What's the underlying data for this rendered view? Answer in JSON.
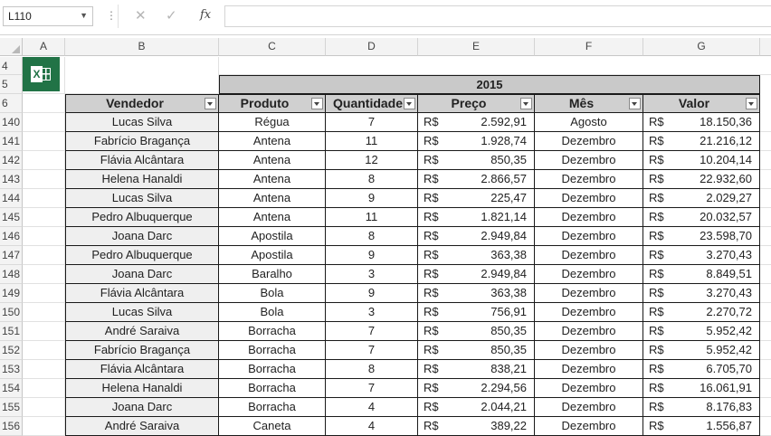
{
  "formula_bar": {
    "name_box": "L110",
    "fx": "fx",
    "cancel": "✕",
    "enter": "✓",
    "formula": ""
  },
  "columns": [
    "A",
    "B",
    "C",
    "D",
    "E",
    "F",
    "G"
  ],
  "top_rows": [
    "4",
    "5",
    "6"
  ],
  "table": {
    "year": "2015",
    "headers": [
      "Vendedor",
      "Produto",
      "Quantidade",
      "Preço",
      "Mês",
      "Valor"
    ],
    "currency": "R$",
    "rows": [
      {
        "row": "140",
        "vendedor": "Lucas Silva",
        "produto": "Régua",
        "qtd": "7",
        "preco": "2.592,91",
        "mes": "Agosto",
        "valor": "18.150,36"
      },
      {
        "row": "141",
        "vendedor": "Fabrício Bragança",
        "produto": "Antena",
        "qtd": "11",
        "preco": "1.928,74",
        "mes": "Dezembro",
        "valor": "21.216,12"
      },
      {
        "row": "142",
        "vendedor": "Flávia Alcântara",
        "produto": "Antena",
        "qtd": "12",
        "preco": "850,35",
        "mes": "Dezembro",
        "valor": "10.204,14"
      },
      {
        "row": "143",
        "vendedor": "Helena Hanaldi",
        "produto": "Antena",
        "qtd": "8",
        "preco": "2.866,57",
        "mes": "Dezembro",
        "valor": "22.932,60"
      },
      {
        "row": "144",
        "vendedor": "Lucas Silva",
        "produto": "Antena",
        "qtd": "9",
        "preco": "225,47",
        "mes": "Dezembro",
        "valor": "2.029,27"
      },
      {
        "row": "145",
        "vendedor": "Pedro Albuquerque",
        "produto": "Antena",
        "qtd": "11",
        "preco": "1.821,14",
        "mes": "Dezembro",
        "valor": "20.032,57"
      },
      {
        "row": "146",
        "vendedor": "Joana Darc",
        "produto": "Apostila",
        "qtd": "8",
        "preco": "2.949,84",
        "mes": "Dezembro",
        "valor": "23.598,70"
      },
      {
        "row": "147",
        "vendedor": "Pedro Albuquerque",
        "produto": "Apostila",
        "qtd": "9",
        "preco": "363,38",
        "mes": "Dezembro",
        "valor": "3.270,43"
      },
      {
        "row": "148",
        "vendedor": "Joana Darc",
        "produto": "Baralho",
        "qtd": "3",
        "preco": "2.949,84",
        "mes": "Dezembro",
        "valor": "8.849,51"
      },
      {
        "row": "149",
        "vendedor": "Flávia Alcântara",
        "produto": "Bola",
        "qtd": "9",
        "preco": "363,38",
        "mes": "Dezembro",
        "valor": "3.270,43"
      },
      {
        "row": "150",
        "vendedor": "Lucas Silva",
        "produto": "Bola",
        "qtd": "3",
        "preco": "756,91",
        "mes": "Dezembro",
        "valor": "2.270,72"
      },
      {
        "row": "151",
        "vendedor": "André Saraiva",
        "produto": "Borracha",
        "qtd": "7",
        "preco": "850,35",
        "mes": "Dezembro",
        "valor": "5.952,42"
      },
      {
        "row": "152",
        "vendedor": "Fabrício Bragança",
        "produto": "Borracha",
        "qtd": "7",
        "preco": "850,35",
        "mes": "Dezembro",
        "valor": "5.952,42"
      },
      {
        "row": "153",
        "vendedor": "Flávia Alcântara",
        "produto": "Borracha",
        "qtd": "8",
        "preco": "838,21",
        "mes": "Dezembro",
        "valor": "6.705,70"
      },
      {
        "row": "154",
        "vendedor": "Helena Hanaldi",
        "produto": "Borracha",
        "qtd": "7",
        "preco": "2.294,56",
        "mes": "Dezembro",
        "valor": "16.061,91"
      },
      {
        "row": "155",
        "vendedor": "Joana Darc",
        "produto": "Borracha",
        "qtd": "4",
        "preco": "2.044,21",
        "mes": "Dezembro",
        "valor": "8.176,83"
      },
      {
        "row": "156",
        "vendedor": "André Saraiva",
        "produto": "Caneta",
        "qtd": "4",
        "preco": "389,22",
        "mes": "Dezembro",
        "valor": "1.556,87"
      }
    ]
  },
  "colors": {
    "excel_green": "#217346",
    "header_fill": "#d0d0d0",
    "year_fill": "#c9c9c9"
  }
}
